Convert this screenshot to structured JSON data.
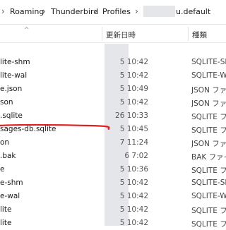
{
  "breadcrumb": [
    "Roaming",
    "Thunderbird",
    "Profiles",
    "u.default"
  ],
  "columns": {
    "date": "更新日時",
    "type": "種類"
  },
  "files": [
    {
      "name": "",
      "date": "",
      "type": ""
    },
    {
      "name": "lite-shm",
      "date": "5 10:42",
      "type": "SQLITE-SHM"
    },
    {
      "name": "lite-wal",
      "date": "5 10:42",
      "type": "SQLITE-WA"
    },
    {
      "name": "e.json",
      "date": "5 10:49",
      "type": "JSON ファイ"
    },
    {
      "name": "son",
      "date": "5 10:42",
      "type": "JSON ファイ"
    },
    {
      "name": ".sqlite",
      "date": "26 10:33",
      "type": "SQLITE ファ"
    },
    {
      "name": "sages-db.sqlite",
      "date": "5 10:45",
      "type": "SQLITE ファ"
    },
    {
      "name": "on",
      "date": "7 11:24",
      "type": "JSON ファイ"
    },
    {
      "name": ".bak",
      "date": "6 7:02",
      "type": "BAK ファイル"
    },
    {
      "name": "e",
      "date": "5 10:36",
      "type": "SQLITE ファ"
    },
    {
      "name": "e-shm",
      "date": "5 10:42",
      "type": "SQLITE-SHN"
    },
    {
      "name": "e-wal",
      "date": "5 10:42",
      "type": "SQLITE-WA"
    },
    {
      "name": "lite",
      "date": "5 10:42",
      "type": "SQLITE ファ"
    },
    {
      "name": "lite",
      "date": "5 10:42",
      "type": "SQLITE ファ"
    }
  ],
  "colors": {
    "annotation": "#e01e1e",
    "redacted": "#e4e6ea"
  },
  "icons": [
    "chevron-right-icon",
    "sort-up-icon"
  ]
}
